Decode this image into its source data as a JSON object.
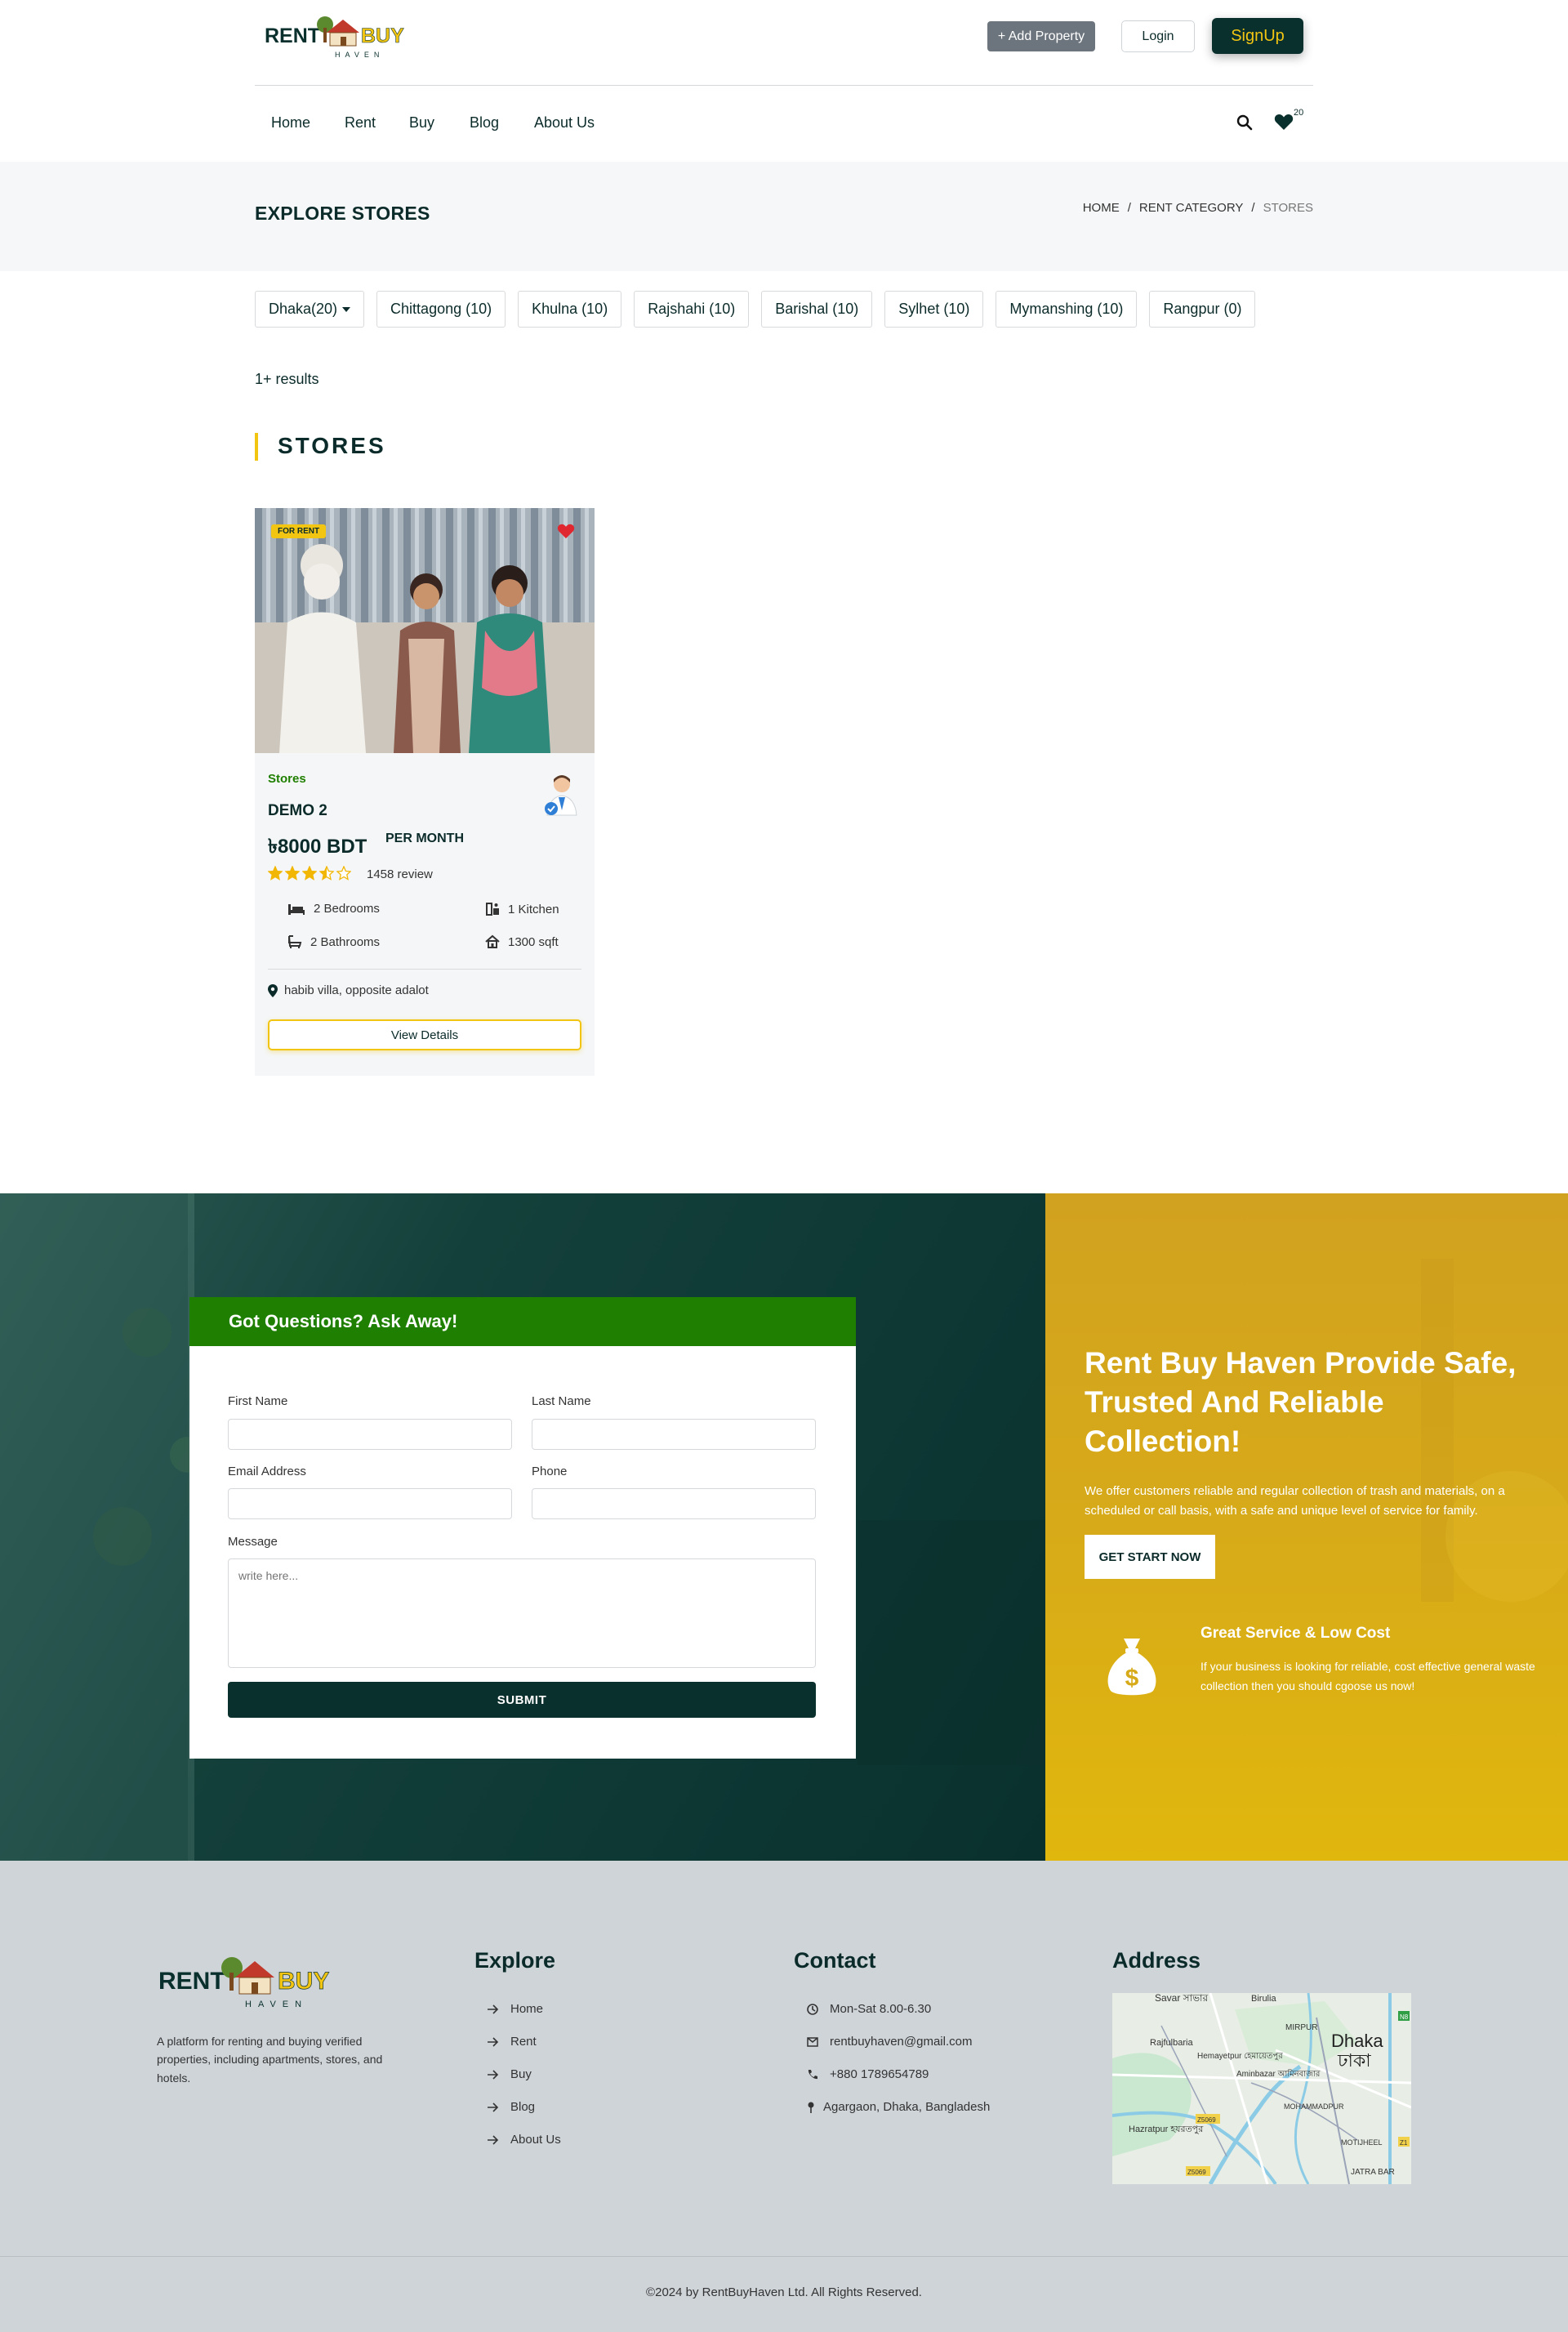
{
  "brand": {
    "word_left": "RENT",
    "word_right": "BUY",
    "tag": "HAVEN",
    "dark": "#0a302d",
    "accent": "#f2c512",
    "green": "#1f7f00"
  },
  "header": {
    "add_property": "+ Add Property",
    "login": "Login",
    "signup": "SignUp",
    "nav": [
      "Home",
      "Rent",
      "Buy",
      "Blog",
      "About Us"
    ],
    "search_icon": "search-icon",
    "wishlist_icon": "heart-icon",
    "wishlist_count": "20"
  },
  "page": {
    "title": "EXPLORE STORES",
    "breadcrumb": [
      "HOME",
      "RENT CATEGORY",
      "STORES"
    ]
  },
  "filters": [
    "Dhaka(20)",
    "Chittagong (10)",
    "Khulna (10)",
    "Rajshahi (10)",
    "Barishal (10)",
    "Sylhet (10)",
    "Mymanshing (10)",
    "Rangpur (0)"
  ],
  "results_text": "1+ results",
  "section_title": "STORES",
  "listing": {
    "badge": "FOR RENT",
    "category": "Stores",
    "name": "DEMO 2",
    "price": "৳8000 BDT",
    "per": "PER MONTH",
    "rating": 3.5,
    "rating_max": 5,
    "reviews": "1458 review",
    "bedrooms": "2 Bedrooms",
    "kitchen": "1 Kitchen",
    "bathrooms": "2 Bathrooms",
    "area": "1300 sqft",
    "location": "habib villa, opposite adalot",
    "view_button": "View Details"
  },
  "contact_form": {
    "heading": "Got Questions? Ask Away!",
    "first_name": "First Name",
    "last_name": "Last Name",
    "email": "Email Address",
    "phone": "Phone",
    "message": "Message",
    "message_placeholder": "write here...",
    "submit": "SUBMIT"
  },
  "promo": {
    "title": "Rent Buy Haven Provide Safe, Trusted And Reliable Collection!",
    "text": "We offer customers reliable and regular collection of trash and materials, on a scheduled or call basis, with a safe and unique level of service for family.",
    "button": "GET START NOW",
    "service_title": "Great Service & Low Cost",
    "service_text": "If your business is looking for reliable, cost effective general waste collection then you should cgoose us now!",
    "service_icon": "money-bag-icon"
  },
  "footer": {
    "description": "A platform for renting and buying verified properties, including apartments, stores, and hotels.",
    "explore_title": "Explore",
    "explore_links": [
      "Home",
      "Rent",
      "Buy",
      "Blog",
      "About Us"
    ],
    "contact_title": "Contact",
    "hours": "Mon-Sat 8.00-6.30",
    "email": "rentbuyhaven@gmail.com",
    "phone": "+880 1789654789",
    "address_line": "Agargaon, Dhaka, Bangladesh",
    "address_title": "Address",
    "map_labels": {
      "savar": "Savar সাভার",
      "birulia": "Birulia",
      "mirpur": "MIRPUR",
      "dhaka": "Dhaka",
      "dhaka_bn": "ঢাকা",
      "rajfulbaria": "Rajfulbaria",
      "hemayetpur": "Hemayetpur হেমায়েতপুর",
      "aminbazar": "Aminbazar আমিনবাজার",
      "mohammadpur": "MOHAMMADPUR",
      "hazratpur": "Hazratpur হযরতপুর",
      "motijheel": "MOTIJHEEL",
      "jatra": "JATRA BAR",
      "road1": "Z5069",
      "road2": "Z5069",
      "road3": "N8",
      "road4": "Z1"
    },
    "copyright": "©2024 by RentBuyHaven Ltd. All Rights Reserved."
  }
}
